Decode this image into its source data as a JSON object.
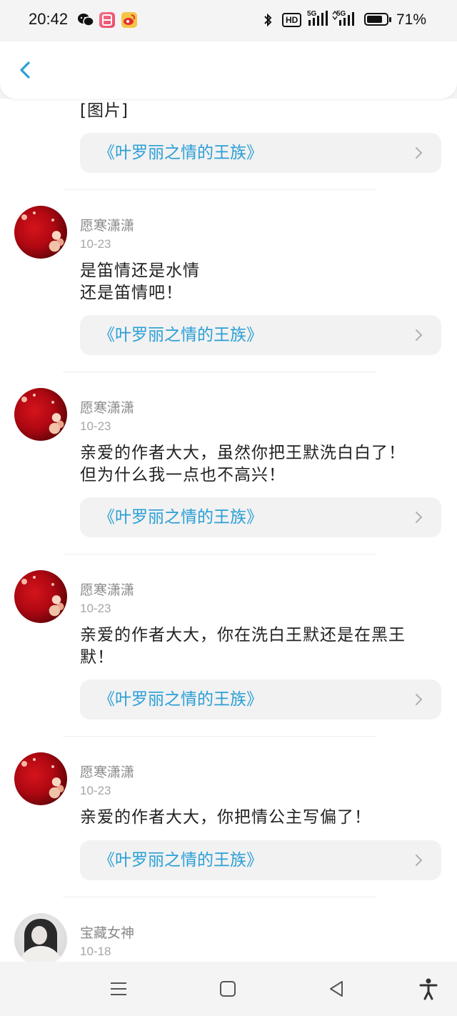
{
  "status_bar": {
    "time": "20:42",
    "network_left": "5G",
    "network_right": "5G",
    "hd_label": "HD",
    "battery_percent": "71%",
    "battery_level": 0.71,
    "icons": [
      "wechat-icon",
      "app-icon",
      "weibo-icon",
      "bluetooth-icon",
      "hd-icon",
      "signal-icon",
      "battery-icon"
    ]
  },
  "header": {
    "back_icon": "chevron-left-icon"
  },
  "partial_top": {
    "comment": "[图片]",
    "book_title": "《叶罗丽之情的王族》"
  },
  "comments": [
    {
      "username": "愿寒潇潇",
      "date": "10-23",
      "lines": [
        "是笛情还是水情",
        "还是笛情吧！"
      ],
      "book_title": "《叶罗丽之情的王族》"
    },
    {
      "username": "愿寒潇潇",
      "date": "10-23",
      "lines": [
        "亲爱的作者大大，虽然你把王默洗白白了！",
        "但为什么我一点也不高兴！"
      ],
      "book_title": "《叶罗丽之情的王族》"
    },
    {
      "username": "愿寒潇潇",
      "date": "10-23",
      "lines": [
        "亲爱的作者大大，你在洗白王默还是在黑王",
        "默！"
      ],
      "book_title": "《叶罗丽之情的王族》"
    },
    {
      "username": "愿寒潇潇",
      "date": "10-23",
      "lines": [
        "亲爱的作者大大，你把情公主写偏了！"
      ],
      "book_title": "《叶罗丽之情的王族》"
    }
  ],
  "partial_bottom": {
    "username": "宝藏女神",
    "date": "10-18"
  },
  "nav_bar": {
    "icons": [
      "menu-icon",
      "home-square-icon",
      "back-triangle-icon",
      "accessibility-icon"
    ]
  },
  "colors": {
    "link": "#2a9fd6",
    "back_arrow": "#2a9fd6",
    "avatar_red": "#b00812"
  }
}
